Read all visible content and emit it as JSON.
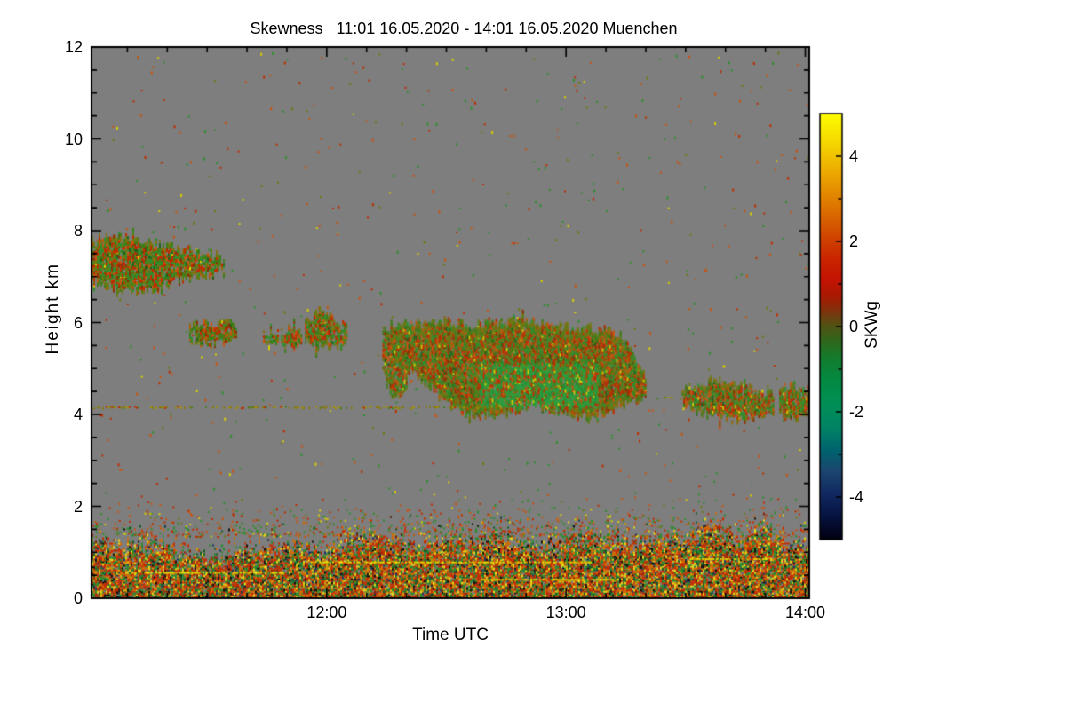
{
  "title": "Skewness   11:01 16.05.2020 - 14:01 16.05.2020 Muenchen",
  "x_axis": {
    "label": "Time UTC",
    "start_time": "11:01",
    "end_time": "14:01",
    "duration_minutes": 180,
    "major_ticks": [
      {
        "minutes": 59,
        "label": "12:00"
      },
      {
        "minutes": 119,
        "label": "13:00"
      },
      {
        "minutes": 179,
        "label": "14:00"
      }
    ],
    "minor_tick_first_offset_minutes": 9,
    "minor_tick_every_minutes": 10
  },
  "y_axis": {
    "label": "Height km",
    "min": 0,
    "max": 12,
    "major_ticks": [
      0,
      2,
      4,
      6,
      8,
      10,
      12
    ],
    "minor_step": 0.5
  },
  "colorbar": {
    "label": "SKWg",
    "min": -5,
    "max": 5,
    "major_ticks": [
      4,
      2,
      0,
      -2,
      -4
    ],
    "minor_ticks": [
      3,
      1,
      -1,
      -3
    ],
    "stops": [
      [
        5.0,
        "#fdfd00"
      ],
      [
        4.4,
        "#f6dc00"
      ],
      [
        3.6,
        "#eca800"
      ],
      [
        2.8,
        "#dd7400"
      ],
      [
        2.2,
        "#d24b00"
      ],
      [
        1.6,
        "#c92500"
      ],
      [
        1.1,
        "#c41303"
      ],
      [
        0.7,
        "#a81a04"
      ],
      [
        0.35,
        "#7c340c"
      ],
      [
        0.05,
        "#555112"
      ],
      [
        -0.3,
        "#33651a"
      ],
      [
        -0.7,
        "#157b2b"
      ],
      [
        -1.2,
        "#048941"
      ],
      [
        -1.8,
        "#009055"
      ],
      [
        -2.4,
        "#008265"
      ],
      [
        -2.9,
        "#00636e"
      ],
      [
        -3.4,
        "#1c4570"
      ],
      [
        -3.9,
        "#112a62"
      ],
      [
        -4.4,
        "#071544"
      ],
      [
        -5.0,
        "#000010"
      ]
    ]
  },
  "chart_data": {
    "type": "heatmap",
    "x_range_minutes": [
      0,
      180
    ],
    "y_range_km": [
      0,
      12
    ],
    "value_range": [
      -5,
      5
    ],
    "background_color": "#7e7e7e",
    "frame_color": "#000000",
    "clouds": [
      {
        "name": "cirrus-band-upper-left",
        "density": 0.8,
        "points": [
          [
            0,
            6.95,
            7.8
          ],
          [
            6,
            6.7,
            7.85
          ],
          [
            14,
            6.72,
            7.75
          ],
          [
            22,
            6.95,
            7.62
          ],
          [
            28,
            7.02,
            7.5
          ],
          [
            33,
            7.18,
            7.38
          ]
        ]
      },
      {
        "name": "small-cloud-1",
        "density": 0.7,
        "points": [
          [
            24.5,
            5.68,
            5.92
          ],
          [
            30,
            5.56,
            6.02
          ],
          [
            36.5,
            5.72,
            5.94
          ]
        ]
      },
      {
        "name": "small-cloud-2",
        "density": 0.65,
        "points": [
          [
            43,
            5.56,
            5.8
          ],
          [
            47,
            5.5,
            5.78
          ]
        ]
      },
      {
        "name": "small-cloud-3",
        "density": 0.7,
        "points": [
          [
            47.5,
            5.52,
            5.82
          ],
          [
            50,
            5.46,
            5.86
          ],
          [
            52.5,
            5.56,
            5.8
          ]
        ]
      },
      {
        "name": "mid-cloud",
        "density": 0.78,
        "points": [
          [
            53.5,
            5.6,
            6.08
          ],
          [
            58,
            5.46,
            6.18
          ],
          [
            62,
            5.5,
            6.02
          ],
          [
            64,
            5.62,
            5.86
          ]
        ]
      },
      {
        "name": "descending-streak",
        "density": 0.72,
        "points": [
          [
            73,
            4.9,
            5.92
          ],
          [
            75,
            4.45,
            5.72
          ],
          [
            77,
            4.32,
            5.3
          ],
          [
            79,
            4.5,
            4.95
          ]
        ]
      },
      {
        "name": "main-cloud",
        "density": 0.93,
        "core": {
          "t0": 97,
          "t1": 127,
          "h0": 4.15,
          "h1": 5.12
        },
        "points": [
          [
            75,
            5.15,
            5.95
          ],
          [
            80,
            5.0,
            6.0
          ],
          [
            85,
            4.62,
            5.96
          ],
          [
            90,
            4.2,
            6.0
          ],
          [
            95,
            4.02,
            5.9
          ],
          [
            100,
            3.98,
            5.95
          ],
          [
            105,
            4.1,
            6.05
          ],
          [
            110,
            4.2,
            6.0
          ],
          [
            115,
            4.15,
            5.97
          ],
          [
            120,
            4.0,
            5.9
          ],
          [
            125,
            3.97,
            5.86
          ],
          [
            130,
            4.1,
            5.8
          ],
          [
            133,
            4.3,
            5.62
          ],
          [
            136,
            4.35,
            5.3
          ],
          [
            139,
            4.42,
            4.78
          ]
        ]
      },
      {
        "name": "right-cloud-1",
        "density": 0.82,
        "points": [
          [
            148,
            4.3,
            4.5
          ],
          [
            152,
            4.08,
            4.62
          ],
          [
            156,
            3.98,
            4.76
          ],
          [
            160,
            3.95,
            4.66
          ],
          [
            164,
            3.9,
            4.56
          ],
          [
            168,
            4.0,
            4.5
          ],
          [
            171,
            4.05,
            4.45
          ]
        ]
      },
      {
        "name": "right-cloud-2",
        "density": 0.8,
        "points": [
          [
            172.5,
            4.0,
            4.56
          ],
          [
            176,
            3.94,
            4.6
          ],
          [
            180,
            3.95,
            4.5
          ]
        ]
      }
    ],
    "dashed_line_segments": [
      {
        "h": 4.15,
        "t0": 0,
        "t1": 104,
        "density": 0.5
      },
      {
        "h": 4.35,
        "t0": 140,
        "t1": 149,
        "density": 0.3
      }
    ],
    "boundary_layer": {
      "top_profile": [
        [
          0,
          1.35
        ],
        [
          8,
          1.15
        ],
        [
          15,
          1.28
        ],
        [
          22,
          1.05
        ],
        [
          30,
          0.95
        ],
        [
          38,
          1.12
        ],
        [
          45,
          1.05
        ],
        [
          52,
          1.22
        ],
        [
          58,
          1.1
        ],
        [
          64,
          1.32
        ],
        [
          70,
          1.5
        ],
        [
          76,
          1.3
        ],
        [
          82,
          1.2
        ],
        [
          88,
          1.35
        ],
        [
          95,
          1.3
        ],
        [
          100,
          1.45
        ],
        [
          106,
          1.35
        ],
        [
          112,
          1.2
        ],
        [
          118,
          1.32
        ],
        [
          124,
          1.45
        ],
        [
          130,
          1.3
        ],
        [
          136,
          1.25
        ],
        [
          142,
          1.38
        ],
        [
          148,
          1.3
        ],
        [
          152,
          1.55
        ],
        [
          157,
          1.62
        ],
        [
          162,
          1.35
        ],
        [
          166,
          1.5
        ],
        [
          170,
          1.58
        ],
        [
          174,
          1.28
        ],
        [
          177,
          1.15
        ],
        [
          180,
          1.1
        ]
      ]
    },
    "yellow_streaks": [
      {
        "h": 0.55,
        "t0": 10,
        "t1": 48
      },
      {
        "h": 0.78,
        "t0": 55,
        "t1": 125
      },
      {
        "h": 0.4,
        "t0": 98,
        "t1": 132
      },
      {
        "h": 0.85,
        "t0": 150,
        "t1": 170
      }
    ],
    "noise": {
      "upper_count": 650,
      "band_count": 800,
      "band_h": [
        1.35,
        2.3
      ]
    },
    "palettes": {
      "cloud": [
        [
          "#2f8f2f",
          0.2
        ],
        [
          "#3f7d1a",
          0.15
        ],
        [
          "#6d7a12",
          0.2
        ],
        [
          "#bf2e00",
          0.2
        ],
        [
          "#c85410",
          0.12
        ],
        [
          "#8a3206",
          0.07
        ],
        [
          "#d8ce00",
          0.02
        ],
        [
          "#23611c",
          0.04
        ]
      ],
      "cloud_edge": [
        [
          "#6d7a12",
          0.45
        ],
        [
          "#3f7d1a",
          0.3
        ],
        [
          "#8a6c10",
          0.25
        ]
      ],
      "core": [
        [
          "#2b9e3c",
          0.42
        ],
        [
          "#1f8f33",
          0.22
        ],
        [
          "#6d7a12",
          0.1
        ],
        [
          "#bf2e00",
          0.13
        ],
        [
          "#c85410",
          0.08
        ],
        [
          "#d8ce00",
          0.05
        ]
      ],
      "boundary": [
        [
          "#c62d00",
          0.27
        ],
        [
          "#d66a00",
          0.17
        ],
        [
          "#2c8a30",
          0.2
        ],
        [
          "#175c22",
          0.08
        ],
        [
          "#e5d51a",
          0.1
        ],
        [
          "#cf9c00",
          0.04
        ],
        [
          "#14120a",
          0.06
        ],
        [
          "#22355e",
          0.03
        ],
        [
          "#8a2304",
          0.05
        ]
      ],
      "noise": [
        [
          "#c85410",
          0.3
        ],
        [
          "#2f8f2f",
          0.3
        ],
        [
          "#bf2e00",
          0.2
        ],
        [
          "#6d7a12",
          0.1
        ],
        [
          "#d8ce00",
          0.1
        ]
      ],
      "dash": [
        [
          "#8a7a00",
          0.45
        ],
        [
          "#a59200",
          0.3
        ],
        [
          "#bf2e00",
          0.12
        ],
        [
          "#3f7d1a",
          0.13
        ]
      ],
      "streak": [
        [
          "#e8d800",
          0.7
        ],
        [
          "#cf9c00",
          0.3
        ]
      ]
    }
  }
}
